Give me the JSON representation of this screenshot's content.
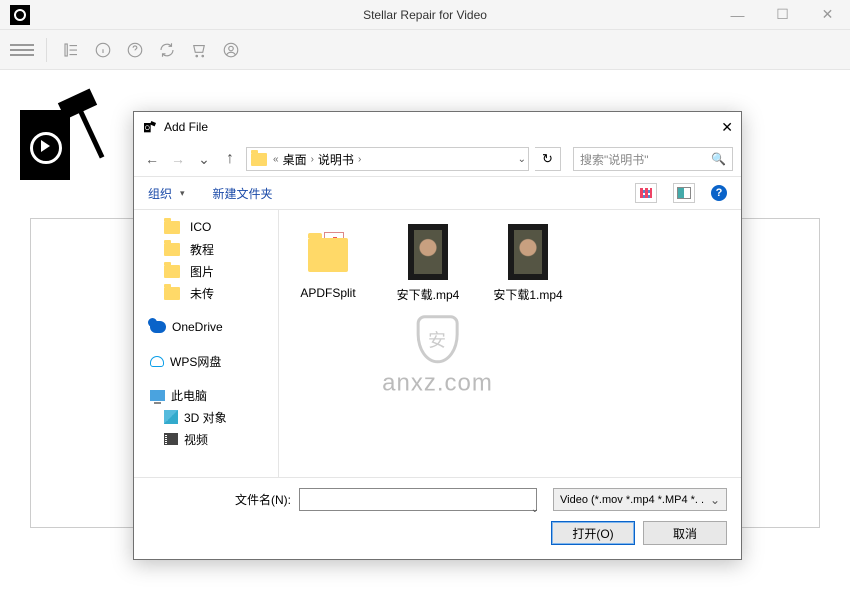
{
  "app": {
    "title": "Stellar Repair for Video",
    "win": {
      "min": "—",
      "max": "☐",
      "close": "✕"
    }
  },
  "dialog": {
    "title": "Add File",
    "close": "✕",
    "nav": {
      "back": "←",
      "forward": "→",
      "recent": "⌄",
      "up": "↑",
      "refresh": "↻"
    },
    "breadcrumb": {
      "segments": [
        "桌面",
        "说明书"
      ],
      "sep": "›",
      "lead": "«"
    },
    "search": {
      "placeholder": "搜索\"说明书\"",
      "icon": "🔍"
    },
    "toolbar": {
      "organize": "组织",
      "tri": "▾",
      "newfolder": "新建文件夹",
      "help": "?"
    },
    "tree": [
      {
        "type": "folder",
        "label": "ICO",
        "indent": true
      },
      {
        "type": "folder",
        "label": "教程",
        "indent": true
      },
      {
        "type": "folder",
        "label": "图片",
        "indent": true
      },
      {
        "type": "folder",
        "label": "未传",
        "indent": true
      },
      {
        "type": "sep"
      },
      {
        "type": "onedrive",
        "label": "OneDrive"
      },
      {
        "type": "sep"
      },
      {
        "type": "wps",
        "label": "WPS网盘"
      },
      {
        "type": "sep"
      },
      {
        "type": "pc",
        "label": "此电脑"
      },
      {
        "type": "3d",
        "label": "3D 对象",
        "indent": true
      },
      {
        "type": "vid",
        "label": "视频",
        "indent": true
      }
    ],
    "files": [
      {
        "kind": "folder",
        "name": "APDFSplit"
      },
      {
        "kind": "video",
        "name": "安下载.mp4"
      },
      {
        "kind": "video",
        "name": "安下载1.mp4"
      }
    ],
    "watermark": {
      "shield": "安",
      "text": "anxz.com"
    },
    "footer": {
      "filename_label": "文件名(N):",
      "filename_value": "",
      "filter": "Video (*.mov *.mp4 *.MP4 *. .",
      "open": "打开(O)",
      "cancel": "取消"
    }
  }
}
